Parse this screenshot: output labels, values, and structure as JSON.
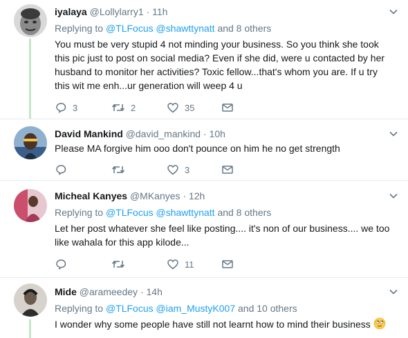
{
  "tweets": [
    {
      "name": "iyalaya",
      "handle": "@Lollylarry1",
      "sep": "·",
      "time": "11h",
      "replying_prefix": "Replying to",
      "replying_user1": "@TLFocus",
      "replying_user2": "@shawttynatt",
      "replying_suffix": "and 8 others",
      "text": "You must be very stupid 4 not minding your business. So you think she took this pic just to post on social media? Even if she did, were u contacted by her husband to monitor her activities? Toxic fellow...that's whom you are. If u try this wit me enh...ur generation will weep 4 u",
      "replies": "3",
      "retweets": "2",
      "likes": "35",
      "avatar_color": "#8a8a8a"
    },
    {
      "name": "David Mankind",
      "handle": "@david_mankind",
      "sep": "·",
      "time": "10h",
      "text": "Please MA forgive him ooo don't pounce on him he no get strength",
      "replies": "",
      "retweets": "",
      "likes": "3",
      "avatar_color": "#3a5f8a"
    },
    {
      "name": "Micheal Kanyes",
      "handle": "@MKanyes",
      "sep": "·",
      "time": "12h",
      "replying_prefix": "Replying to",
      "replying_user1": "@TLFocus",
      "replying_user2": "@shawttynatt",
      "replying_suffix": "and 8 others",
      "text": "Let her post whatever she feel like posting.... it's non of our business.... we too like wahala for this app kilode...",
      "replies": "",
      "retweets": "",
      "likes": "11",
      "avatar_color": "#c94f6d"
    },
    {
      "name": "Mide",
      "handle": "@arameedey",
      "sep": "·",
      "time": "14h",
      "replying_prefix": "Replying to",
      "replying_user1": "@TLFocus",
      "replying_user2": "@iam_MustyK007",
      "replying_suffix": "and 10 others",
      "text": "I wonder why some people have still not learnt how to mind their business",
      "avatar_color": "#6b5a4e"
    }
  ],
  "colors": {
    "link": "#1da1f2",
    "muted": "#657786",
    "thread_line": "#c4e6c7",
    "separator": "#e6ecf0"
  },
  "icons": [
    "reply-icon",
    "retweet-icon",
    "like-icon",
    "dm-icon",
    "chevron-down-icon",
    "emoji-rolling-eyes-icon"
  ]
}
